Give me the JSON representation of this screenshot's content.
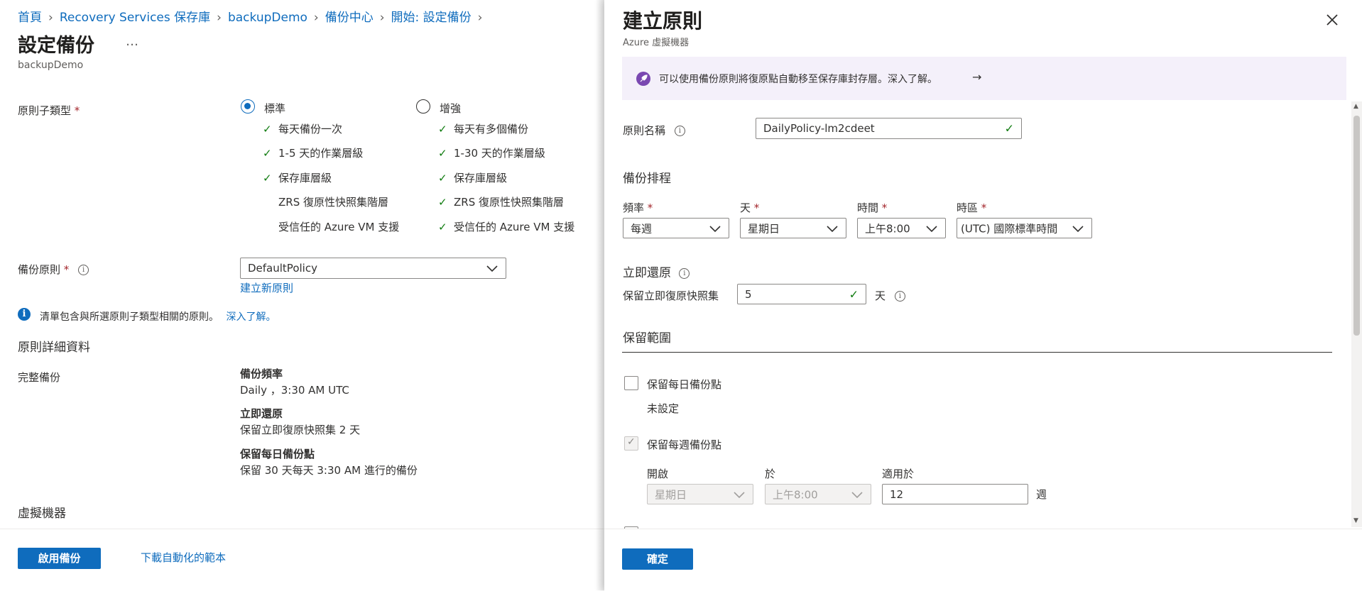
{
  "breadcrumb": [
    "首頁",
    "Recovery Services 保存庫",
    "backupDemo",
    "備份中心",
    "開始: 設定備份"
  ],
  "page": {
    "title": "設定備份",
    "more": "…",
    "subtitle": "backupDemo"
  },
  "policy_subtype": {
    "label": "原則子類型",
    "required_mark": "*",
    "options": [
      {
        "label": "標準",
        "selected": true
      },
      {
        "label": "增強",
        "selected": false
      }
    ],
    "standard_features": [
      {
        "text": "每天備份一次",
        "check": true
      },
      {
        "text": "1-5 天的作業層級",
        "check": true
      },
      {
        "text": "保存庫層級",
        "check": true
      },
      {
        "text": "ZRS 復原性快照集階層",
        "check": false
      },
      {
        "text": "受信任的 Azure VM 支援",
        "check": false
      }
    ],
    "enhanced_features": [
      {
        "text": "每天有多個備份",
        "check": true
      },
      {
        "text": "1-30 天的作業層級",
        "check": true
      },
      {
        "text": "保存庫層級",
        "check": true
      },
      {
        "text": "ZRS 復原性快照集階層",
        "check": true
      },
      {
        "text": "受信任的 Azure VM 支援",
        "check": true
      }
    ]
  },
  "backup_policy": {
    "label": "備份原則",
    "required_mark": "*",
    "value": "DefaultPolicy",
    "create_link": "建立新原則"
  },
  "info_note": {
    "text": "清單包含與所選原則子類型相關的原則。",
    "link": "深入了解。"
  },
  "policy_details": {
    "title": "原則詳細資料",
    "full_backup_label": "完整備份",
    "frequency_title": "備份頻率",
    "frequency_value": "Daily ，3:30 AM UTC",
    "instant_title": "立即還原",
    "instant_value": "保留立即復原快照集 2 天",
    "daily_title": "保留每日備份點",
    "daily_value": "保留 30 天每天 3:30 AM 進行的備份"
  },
  "vm_section": "虛擬機器",
  "left_footer": {
    "enable_button": "啟用備份",
    "download_link": "下載自動化的範本"
  },
  "panel": {
    "title": "建立原則",
    "subtitle": "Azure 虛擬機器",
    "banner": "可以使用備份原則將復原點自動移至保存庫封存層。深入了解。",
    "banner_arrow": "→",
    "policy_name_label": "原則名稱",
    "policy_name_value": "DailyPolicy-lm2cdeet",
    "schedule_title": "備份排程",
    "schedule": [
      {
        "label": "頻率",
        "value": "每週"
      },
      {
        "label": "天",
        "value": "星期日"
      },
      {
        "label": "時間",
        "value": "上午8:00"
      },
      {
        "label": "時區",
        "value": "(UTC) 國際標準時間"
      }
    ],
    "instant_title": "立即還原",
    "instant_label": "保留立即復原快照集",
    "instant_value": "5",
    "instant_unit": "天",
    "retention_title": "保留範圍",
    "daily_checkbox": "保留每日備份點",
    "daily_status": "未設定",
    "weekly_checkbox": "保留每週備份點",
    "weekly_cols": {
      "on": "開啟",
      "at": "於",
      "for": "適用於"
    },
    "weekly_day": "星期日",
    "weekly_time": "上午8:00",
    "weekly_count": "12",
    "weekly_unit": "週",
    "confirm": "確定"
  },
  "colors": {
    "accent": "#0f6cbd",
    "check": "#107c10",
    "banner_bg": "#f4f0fa",
    "rocket": "#7a48b1",
    "required": "#a4262c"
  }
}
